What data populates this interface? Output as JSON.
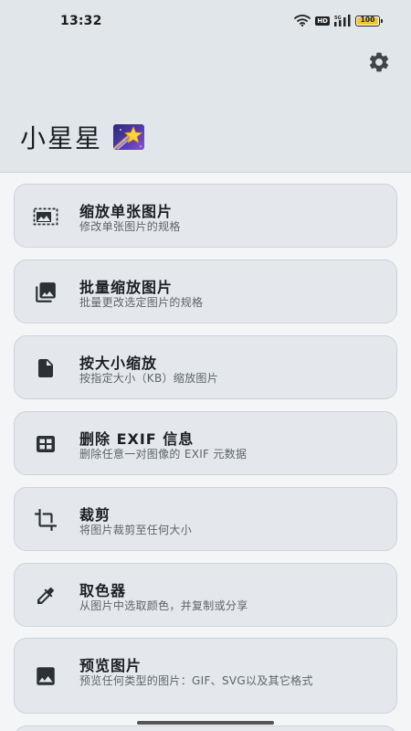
{
  "status_bar": {
    "time": "13:32",
    "hd_label": "HD",
    "battery_label": "100",
    "battery_level": 1.0,
    "icons": [
      "wifi-icon",
      "hd-icon",
      "signal-icon",
      "battery-icon"
    ]
  },
  "header": {
    "title": "小星星",
    "logo_icon": "shooting-star-icon",
    "settings_icon": "gear-icon"
  },
  "colors": {
    "header_bg": "#e1e6ea",
    "page_bg": "#f3f5f7",
    "card_bg": "#e4e8ec",
    "title_text": "#1c1f22",
    "subtitle_text": "#5d6468",
    "battery_fill": "#f4c531"
  },
  "menu": {
    "items": [
      {
        "icon": "resize-image-icon",
        "title": "缩放单张图片",
        "subtitle": "修改单张图片的规格"
      },
      {
        "icon": "photo-library-icon",
        "title": "批量缩放图片",
        "subtitle": "批量更改选定图片的规格"
      },
      {
        "icon": "file-icon",
        "title": "按大小缩放",
        "subtitle": "按指定大小（KB）缩放图片"
      },
      {
        "icon": "grid-icon",
        "title": "删除 EXIF 信息",
        "subtitle": "删除任意一对图像的 EXIF 元数据"
      },
      {
        "icon": "crop-icon",
        "title": "裁剪",
        "subtitle": "将图片裁剪至任何大小"
      },
      {
        "icon": "eyedropper-icon",
        "title": "取色器",
        "subtitle": "从图片中选取颜色，并复制或分享"
      },
      {
        "icon": "image-icon",
        "title": "预览图片",
        "subtitle": "预览任何类型的图片：GIF、SVG以及其它格式"
      }
    ]
  }
}
